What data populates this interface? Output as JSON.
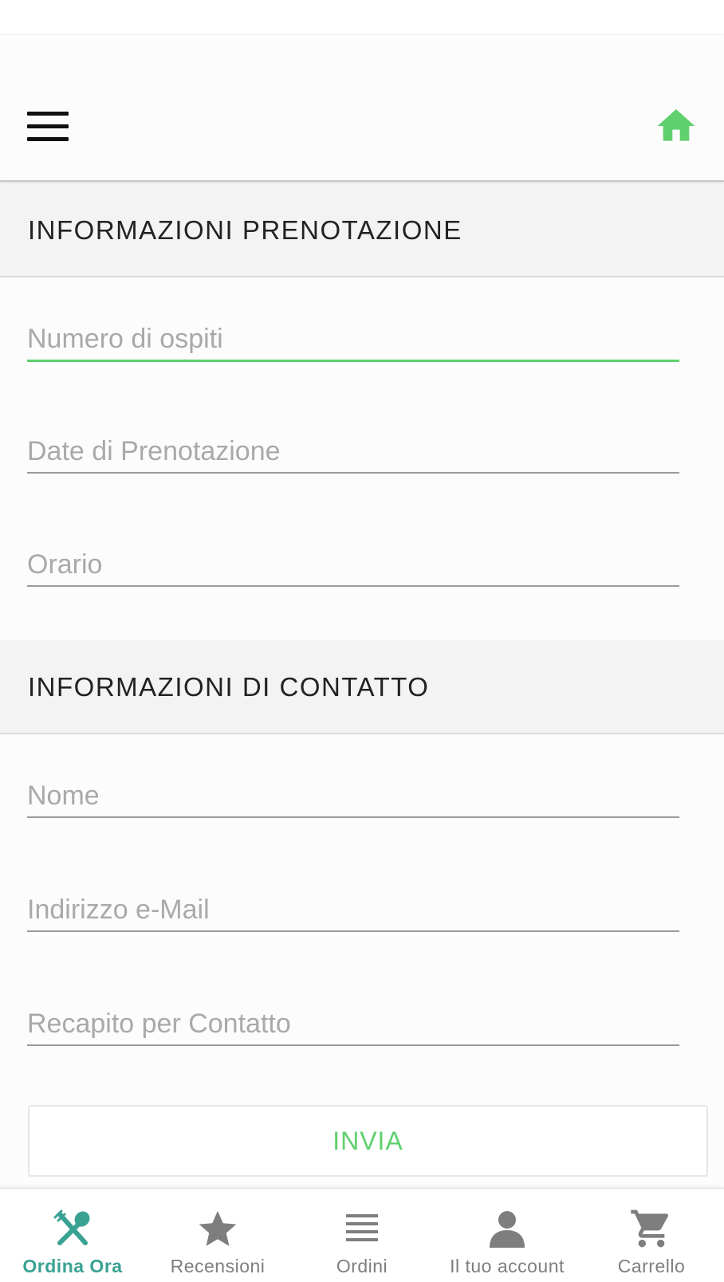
{
  "app": {
    "accent_color": "#5fd06d",
    "active_tab_color": "#3aa293",
    "icons": {
      "menu": "hamburger-menu-icon",
      "home": "home-icon"
    }
  },
  "sections": {
    "booking": {
      "title": "INFORMAZIONI PRENOTAZIONE",
      "fields": {
        "guests": {
          "placeholder": "Numero di ospiti",
          "value": ""
        },
        "date": {
          "placeholder": "Date di Prenotazione",
          "value": ""
        },
        "time": {
          "placeholder": "Orario",
          "value": ""
        }
      }
    },
    "contact": {
      "title": "INFORMAZIONI DI CONTATTO",
      "fields": {
        "name": {
          "placeholder": "Nome",
          "value": ""
        },
        "email": {
          "placeholder": "Indirizzo e-Mail",
          "value": ""
        },
        "phone": {
          "placeholder": "Recapito per Contatto",
          "value": ""
        }
      }
    }
  },
  "form": {
    "submit_label": "INVIA"
  },
  "tabbar": {
    "tabs": [
      {
        "label": "Ordina Ora",
        "icon": "fork-spoon-icon",
        "active": true
      },
      {
        "label": "Recensioni",
        "icon": "star-icon",
        "active": false
      },
      {
        "label": "Ordini",
        "icon": "list-icon",
        "active": false
      },
      {
        "label": "Il tuo account",
        "icon": "person-icon",
        "active": false
      },
      {
        "label": "Carrello",
        "icon": "cart-icon",
        "active": false
      }
    ]
  }
}
